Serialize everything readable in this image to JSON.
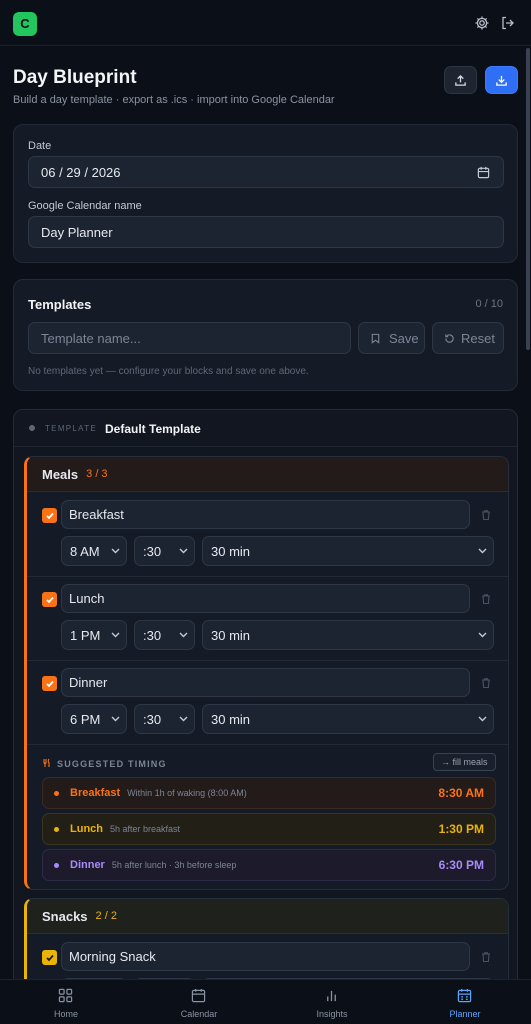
{
  "app": {
    "logo_letter": "C"
  },
  "header": {
    "title": "Day Blueprint",
    "subtitle": "Build a day template · export as .ics · import into Google Calendar"
  },
  "settings_card": {
    "date_label": "Date",
    "date_value": "06 / 29 / 2026",
    "calendar_label": "Google Calendar name",
    "calendar_value": "Day Planner"
  },
  "templates_card": {
    "title": "Templates",
    "count": "0 / 10",
    "name_placeholder": "Template name...",
    "save_label": "Save",
    "reset_label": "Reset",
    "empty_text": "No templates yet — configure your blocks and save one above."
  },
  "template": {
    "tag": "TEMPLATE",
    "name": "Default Template"
  },
  "meals": {
    "title": "Meals",
    "count": "3 / 3",
    "items": [
      {
        "name": "Breakfast",
        "hour": "8 AM",
        "minute": ":30",
        "duration": "30 min",
        "checked": true
      },
      {
        "name": "Lunch",
        "hour": "1 PM",
        "minute": ":30",
        "duration": "30 min",
        "checked": true
      },
      {
        "name": "Dinner",
        "hour": "6 PM",
        "minute": ":30",
        "duration": "30 min",
        "checked": true
      }
    ],
    "suggested_title": "SUGGESTED TIMING",
    "fill_label": "→ fill meals",
    "suggestions": [
      {
        "name": "Breakfast",
        "note": "Within 1h of waking (8:00 AM)",
        "time": "8:30 AM",
        "color": "#f97316"
      },
      {
        "name": "Lunch",
        "note": "5h after breakfast",
        "time": "1:30 PM",
        "color": "#eab308"
      },
      {
        "name": "Dinner",
        "note": "5h after lunch · 3h before sleep",
        "time": "6:30 PM",
        "color": "#a78bfa"
      }
    ]
  },
  "snacks": {
    "title": "Snacks",
    "count": "2 / 2",
    "items": [
      {
        "name": "Morning Snack",
        "checked": true
      }
    ]
  },
  "nav": {
    "items": [
      "Home",
      "Calendar",
      "Insights",
      "Planner"
    ],
    "active": "Planner"
  },
  "colors": {
    "accent_blue": "#2f6ff5",
    "meals_accent": "#f97316",
    "snacks_accent": "#eab308",
    "logo_green": "#22c55e"
  }
}
